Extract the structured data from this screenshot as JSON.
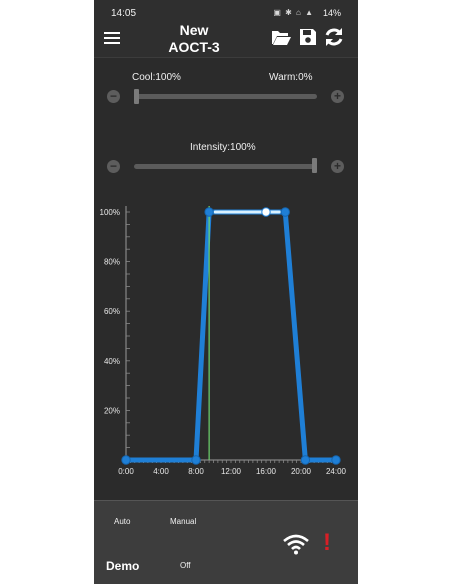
{
  "status": {
    "time": "14:05",
    "battery": "14%"
  },
  "header": {
    "title_line1": "New",
    "title_line2": "AOCT-3"
  },
  "sliders": {
    "cool_label": "Cool:100%",
    "warm_label": "Warm:0%",
    "cool_value": 0.0,
    "intensity_label": "Intensity:100%",
    "intensity_value": 1.0,
    "minus": "−",
    "plus": "+"
  },
  "chart_data": {
    "type": "line",
    "x_ticks": [
      "0:00",
      "4:00",
      "8:00",
      "12:00",
      "16:00",
      "20:00",
      "24:00"
    ],
    "y_ticks": [
      "20%",
      "40%",
      "60%",
      "80%",
      "100%"
    ],
    "xlim": [
      0,
      24
    ],
    "ylim": [
      0,
      100
    ],
    "series": [
      {
        "x": [
          0,
          8,
          9.5,
          16,
          18.2,
          20.5,
          24
        ],
        "y": [
          0,
          0,
          100,
          100,
          100,
          0,
          0
        ]
      }
    ],
    "current_time_marker": 9.5
  },
  "bottom": {
    "auto_label": "Auto",
    "manual_label": "Manual",
    "demo_label": "Demo",
    "off_label": "Off",
    "alert": "!"
  }
}
